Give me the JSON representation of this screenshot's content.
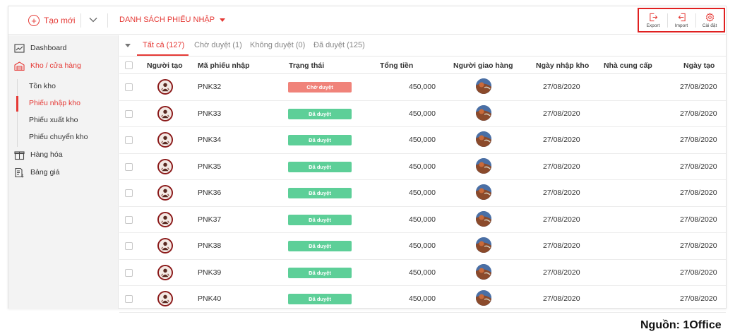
{
  "header": {
    "create_label": "Tạo mới",
    "list_title": "DANH SÁCH PHIẾU NHẬP",
    "actions": [
      {
        "label": "Export",
        "icon": "export-icon"
      },
      {
        "label": "Import",
        "icon": "import-icon"
      },
      {
        "label": "Cài đặt",
        "icon": "gear-icon"
      }
    ]
  },
  "sidebar": {
    "items": [
      {
        "label": "Dashboard",
        "icon": "dashboard-icon"
      },
      {
        "label": "Kho / cửa hàng",
        "icon": "warehouse-icon"
      },
      {
        "label": "Hàng hóa",
        "icon": "box-icon"
      },
      {
        "label": "Bảng giá",
        "icon": "price-list-icon"
      }
    ],
    "sub_items": [
      "Tồn kho",
      "Phiếu nhập kho",
      "Phiếu xuất kho",
      "Phiếu chuyển kho"
    ]
  },
  "tabs": [
    "Tất cả (127)",
    "Chờ duyệt (1)",
    "Không duyệt (0)",
    "Đã duyệt (125)"
  ],
  "table": {
    "columns": [
      "Người tạo",
      "Mã phiếu nhập",
      "Trạng thái",
      "Tổng tiền",
      "Người giao hàng",
      "Ngày nhập kho",
      "Nhà cung cấp",
      "Ngày tạo"
    ],
    "rows": [
      {
        "code": "PNK32",
        "status": "Chờ duyệt",
        "total": "450,000",
        "import_date": "27/08/2020",
        "supplier": "",
        "created": "27/08/2020"
      },
      {
        "code": "PNK33",
        "status": "Đã duyệt",
        "total": "450,000",
        "import_date": "27/08/2020",
        "supplier": "",
        "created": "27/08/2020"
      },
      {
        "code": "PNK34",
        "status": "Đã duyệt",
        "total": "450,000",
        "import_date": "27/08/2020",
        "supplier": "",
        "created": "27/08/2020"
      },
      {
        "code": "PNK35",
        "status": "Đã duyệt",
        "total": "450,000",
        "import_date": "27/08/2020",
        "supplier": "",
        "created": "27/08/2020"
      },
      {
        "code": "PNK36",
        "status": "Đã duyệt",
        "total": "450,000",
        "import_date": "27/08/2020",
        "supplier": "",
        "created": "27/08/2020"
      },
      {
        "code": "PNK37",
        "status": "Đã duyệt",
        "total": "450,000",
        "import_date": "27/08/2020",
        "supplier": "",
        "created": "27/08/2020"
      },
      {
        "code": "PNK38",
        "status": "Đã duyệt",
        "total": "450,000",
        "import_date": "27/08/2020",
        "supplier": "",
        "created": "27/08/2020"
      },
      {
        "code": "PNK39",
        "status": "Đã duyệt",
        "total": "450,000",
        "import_date": "27/08/2020",
        "supplier": "",
        "created": "27/08/2020"
      },
      {
        "code": "PNK40",
        "status": "Đã duyệt",
        "total": "450,000",
        "import_date": "27/08/2020",
        "supplier": "",
        "created": "27/08/2020"
      }
    ]
  },
  "colors": {
    "accent": "#e53935",
    "pending": "#f0837a",
    "approved": "#5dcf98"
  },
  "source": "Nguồn: 1Office"
}
